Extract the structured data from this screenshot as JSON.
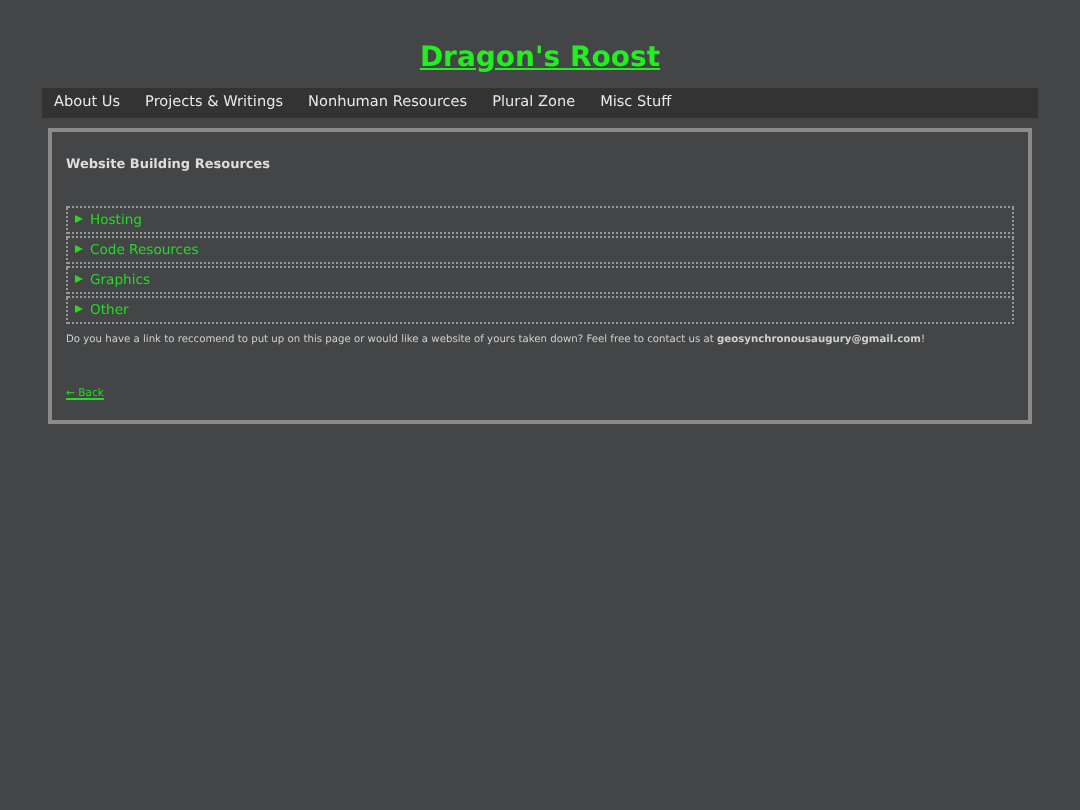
{
  "site_title": "Dragon's Roost",
  "nav": [
    "About Us",
    "Projects & Writings",
    "Nonhuman Resources",
    "Plural Zone",
    "Misc Stuff"
  ],
  "heading": "Website Building Resources",
  "sections": [
    {
      "label": "Hosting",
      "expanded": false
    },
    {
      "label": "Code Resources",
      "expanded": false
    },
    {
      "label": "Graphics",
      "expanded": false
    },
    {
      "label": "Other",
      "expanded": false
    }
  ],
  "note": "Do you have a link to reccomend to put up on this page or would like a website of yours taken down? Feel free to contact us at **geosynchronousaugury@gmail.com**!",
  "back_link": "← Back"
}
